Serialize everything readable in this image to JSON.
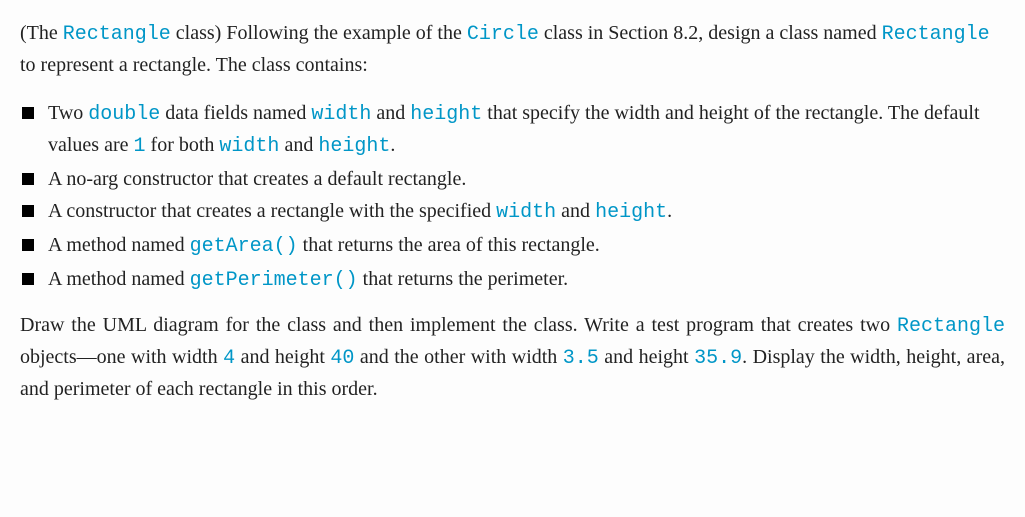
{
  "intro": {
    "part1": "(The ",
    "className": "Rectangle",
    "part2": " class) Following the example of the ",
    "circleClass": "Circle",
    "part3": " class in Section 8.2, design a class named ",
    "className2": "Rectangle",
    "part4": " to represent a rectangle. The class contains:"
  },
  "bullets": {
    "b1": {
      "p1": "Two ",
      "kw1": "double",
      "p2": " data fields named ",
      "kw2": "width",
      "p3": " and ",
      "kw3": "height",
      "p4": " that specify the width and height of the rectangle. The default values are ",
      "kw4": "1",
      "p5": " for both ",
      "kw5": "width",
      "p6": " and ",
      "kw6": "height",
      "p7": "."
    },
    "b2": {
      "p1": "A no-arg constructor that creates a default rectangle."
    },
    "b3": {
      "p1": "A constructor that creates a rectangle with the specified ",
      "kw1": "width",
      "p2": " and ",
      "kw2": "height",
      "p3": "."
    },
    "b4": {
      "p1": "A method named ",
      "kw1": "getArea()",
      "p2": " that returns the area of this rectangle."
    },
    "b5": {
      "p1": "A method named ",
      "kw1": "getPerimeter()",
      "p2": " that returns the perimeter."
    }
  },
  "outro": {
    "p1": "Draw the UML diagram for the class and then implement the class. Write a test program that creates two ",
    "kw1": "Rectangle",
    "p2": " objects—one with width ",
    "n1": "4",
    "p3": " and height ",
    "n2": "40",
    "p4": " and the other with width ",
    "n3": "3.5",
    "p5": " and height ",
    "n4": "35.9",
    "p6": ". Display the width, height, area, and perimeter of each rectangle in this order."
  }
}
